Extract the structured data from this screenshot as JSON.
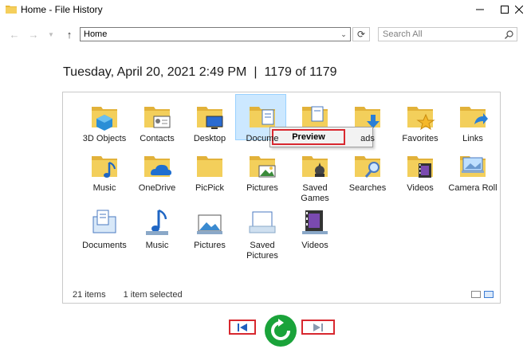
{
  "window": {
    "title": "Home - File History",
    "controls": [
      "minimize",
      "maximize",
      "close"
    ]
  },
  "navigation": {
    "back_icon": "back-arrow-icon",
    "forward_icon": "forward-arrow-icon",
    "recent_icon": "chevron-down-icon",
    "up_icon": "up-arrow-icon",
    "address": "Home",
    "search_placeholder": "Search All"
  },
  "header": {
    "datetime": "Tuesday, April 20, 2021 2:49 PM",
    "separator": "|",
    "position": "1179 of 1179"
  },
  "items": [
    {
      "label": "3D Objects",
      "icon": "3d-objects-icon"
    },
    {
      "label": "Contacts",
      "icon": "contacts-icon"
    },
    {
      "label": "Desktop",
      "icon": "desktop-icon"
    },
    {
      "label": "Docume",
      "icon": "documents-folder-icon",
      "selected": true
    },
    {
      "label": "",
      "icon": "downloads-partial-icon"
    },
    {
      "label": "ads",
      "icon": "downloads-icon"
    },
    {
      "label": "Favorites",
      "icon": "favorites-icon"
    },
    {
      "label": "Links",
      "icon": "links-icon"
    },
    {
      "label": "Music",
      "icon": "music-folder-icon"
    },
    {
      "label": "OneDrive",
      "icon": "onedrive-icon"
    },
    {
      "label": "PicPick",
      "icon": "folder-icon"
    },
    {
      "label": "Pictures",
      "icon": "pictures-folder-icon"
    },
    {
      "label": "Saved Games",
      "icon": "saved-games-icon"
    },
    {
      "label": "Searches",
      "icon": "searches-icon"
    },
    {
      "label": "Videos",
      "icon": "videos-folder-icon"
    },
    {
      "label": "Camera Roll",
      "icon": "camera-roll-icon"
    },
    {
      "label": "Documents",
      "icon": "documents-library-icon"
    },
    {
      "label": "Music",
      "icon": "music-library-icon"
    },
    {
      "label": "Pictures",
      "icon": "pictures-library-icon"
    },
    {
      "label": "Saved Pictures",
      "icon": "saved-pictures-icon"
    },
    {
      "label": "Videos",
      "icon": "videos-library-icon"
    }
  ],
  "status": {
    "count": "21 items",
    "selection": "1 item selected"
  },
  "context_menu": {
    "preview": "Preview"
  },
  "playback": {
    "previous_icon": "previous-version-icon",
    "restore_icon": "restore-icon",
    "next_icon": "next-version-icon"
  },
  "colors": {
    "highlight": "#d8282f",
    "restore_green": "#1aa33a",
    "selection": "#cce8ff",
    "folder": "#f0c84a"
  }
}
